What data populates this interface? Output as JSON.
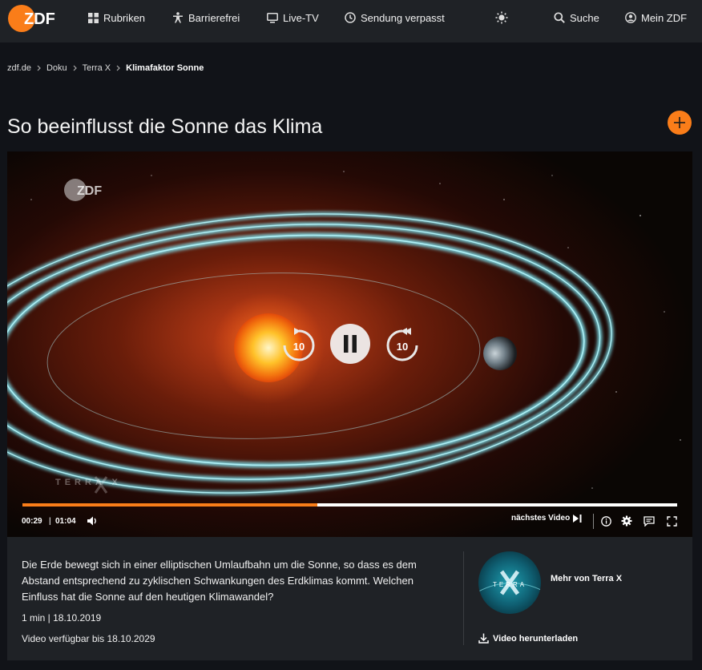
{
  "brand": {
    "logo_text": "ZDF",
    "accent": "#fa7d19"
  },
  "nav": {
    "items": [
      {
        "label": "Rubriken",
        "icon": "grid-icon"
      },
      {
        "label": "Barrierefrei",
        "icon": "accessibility-icon"
      },
      {
        "label": "Live-TV",
        "icon": "tv-icon"
      },
      {
        "label": "Sendung verpasst",
        "icon": "clock-icon"
      }
    ],
    "theme_icon": "sun-icon",
    "search_label": "Suche",
    "account_label": "Mein ZDF"
  },
  "breadcrumb": [
    "zdf.de",
    "Doku",
    "Terra X",
    "Klimafaktor Sonne"
  ],
  "page_title": "So beeinflusst die Sonne das Klima",
  "player": {
    "watermark": "ZDF",
    "terra_watermark": "TERRA X",
    "skip_back_seconds": "10",
    "skip_forward_seconds": "10",
    "current_time": "00:29",
    "duration": "01:04",
    "progress": 0.45,
    "next_video_label": "nächstes Video",
    "progress_color": "#fa7d19"
  },
  "info": {
    "description": "Die Erde bewegt sich in einer elliptischen Umlaufbahn um die Sonne, so dass es dem Abstand entsprechend zu zyklischen Schwankungen des Erdklimas kommt. Welchen Einfluss hat die Sonne auf den heutigen Klimawandel?",
    "meta": "1 min | 18.10.2019",
    "availability": "Video verfügbar bis 18.10.2029",
    "more_label": "Mehr von Terra X",
    "download_label": "Video herunterladen",
    "thumb_text": "TERRA"
  }
}
